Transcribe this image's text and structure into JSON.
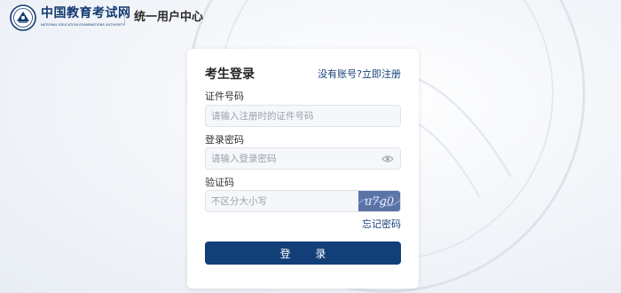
{
  "header": {
    "logo_cn": "中国教育考试网",
    "logo_en": "NATIONAL EDUCATION EXAMINATIONS AUTHORITY",
    "center_title": "统一用户中心"
  },
  "login": {
    "title": "考生登录",
    "register_link": "没有账号?立即注册",
    "id_label": "证件号码",
    "id_placeholder": "请输入注册时的证件号码",
    "password_label": "登录密码",
    "password_placeholder": "请输入登录密码",
    "captcha_label": "验证码",
    "captcha_placeholder": "不区分大小写",
    "captcha_text": "u7g0",
    "forgot_link": "忘记密码",
    "submit_label": "登 录"
  },
  "colors": {
    "brand": "#123f78",
    "link": "#153f7c"
  },
  "icons": {
    "logo": "neea-emblem-icon",
    "password_toggle": "eye-icon",
    "captcha": "captcha-image"
  }
}
